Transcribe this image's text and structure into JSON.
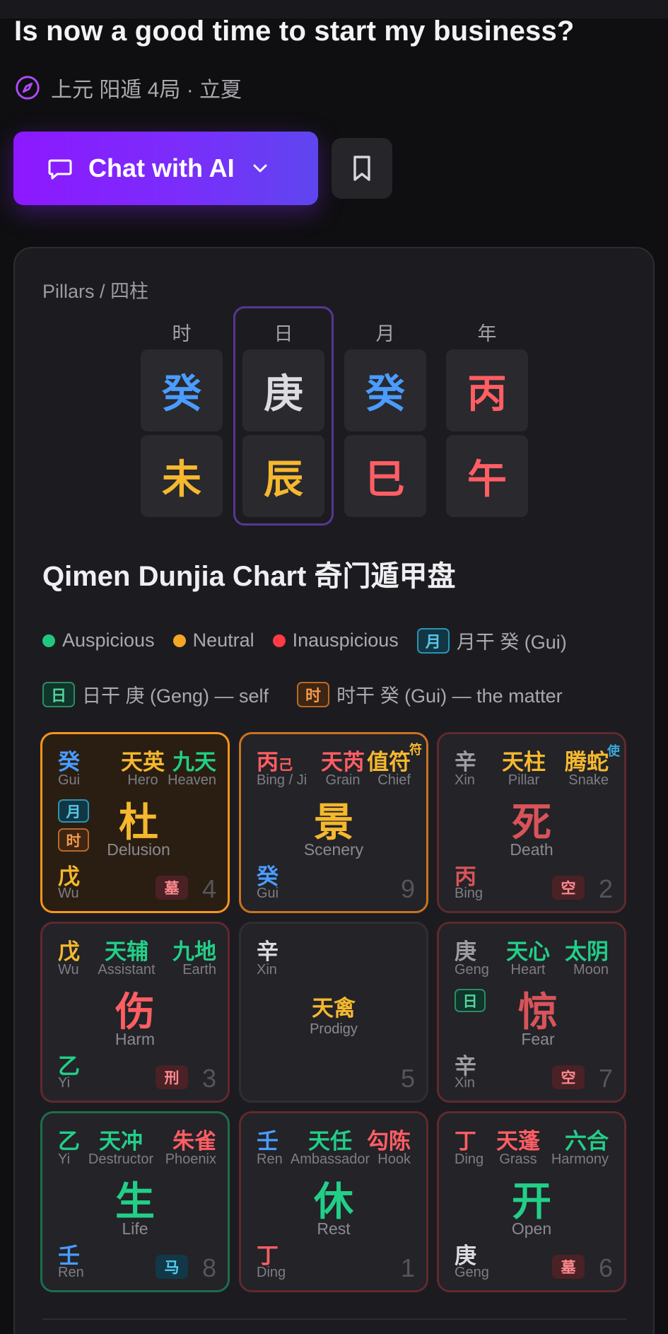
{
  "header": {
    "question": "Is now a good time to start my business?",
    "subtitle": "上元 阳遁 4局 · 立夏"
  },
  "actions": {
    "chat_label": "Chat with AI"
  },
  "pillars": {
    "label": "Pillars / 四柱",
    "columns": [
      {
        "head": "时",
        "stem": "癸",
        "branch": "未"
      },
      {
        "head": "日",
        "stem": "庚",
        "branch": "辰"
      },
      {
        "head": "月",
        "stem": "癸",
        "branch": "巳"
      },
      {
        "head": "年",
        "stem": "丙",
        "branch": "午"
      }
    ]
  },
  "chart": {
    "title": "Qimen Dunjia Chart 奇门遁甲盘",
    "legend": {
      "auspicious": "Auspicious",
      "neutral": "Neutral",
      "inauspicious": "Inauspicious",
      "month_tag": "月",
      "month_text": "月干 癸 (Gui)",
      "day_tag": "日",
      "day_text": "日干 庚 (Geng) — self",
      "hour_tag": "时",
      "hour_text": "时干 癸 (Gui) — the matter"
    },
    "colors": {
      "auspicious": "#1fc77f",
      "neutral": "#f5a623",
      "inauspicious": "#ff3b44"
    },
    "palaces": {
      "p4": {
        "heaven_stem": "癸",
        "heaven_py": "Gui",
        "star": "天英",
        "star_en": "Hero",
        "deity": "九天",
        "deity_en": "Heaven",
        "tag_month": "月",
        "tag_hour": "时",
        "door": "杜",
        "door_en": "Delusion",
        "earth_stem": "戊",
        "earth_py": "Wu",
        "badge": "墓",
        "number": "4"
      },
      "p9": {
        "heaven_stem": "丙",
        "heaven_extra": "己",
        "heaven_py": "Bing / Ji",
        "star": "天芮",
        "star_en": "Grain",
        "deity": "值符",
        "deity_en": "Chief",
        "sup": "符",
        "door": "景",
        "door_en": "Scenery",
        "earth_stem": "癸",
        "earth_py": "Gui",
        "number": "9"
      },
      "p2": {
        "heaven_stem": "辛",
        "heaven_py": "Xin",
        "star": "天柱",
        "star_en": "Pillar",
        "deity": "腾蛇",
        "deity_en": "Snake",
        "sup": "使",
        "door": "死",
        "door_en": "Death",
        "earth_stem": "丙",
        "earth_py": "Bing",
        "badge": "空",
        "number": "2"
      },
      "p3": {
        "heaven_stem": "戊",
        "heaven_py": "Wu",
        "star": "天辅",
        "star_en": "Assistant",
        "deity": "九地",
        "deity_en": "Earth",
        "door": "伤",
        "door_en": "Harm",
        "earth_stem": "乙",
        "earth_py": "Yi",
        "badge": "刑",
        "number": "3"
      },
      "p5": {
        "heaven_stem": "辛",
        "heaven_py": "Xin",
        "star": "天禽",
        "star_en": "Prodigy",
        "number": "5"
      },
      "p7": {
        "heaven_stem": "庚",
        "heaven_py": "Geng",
        "star": "天心",
        "star_en": "Heart",
        "deity": "太阴",
        "deity_en": "Moon",
        "tag_day": "日",
        "door": "惊",
        "door_en": "Fear",
        "earth_stem": "辛",
        "earth_py": "Xin",
        "badge": "空",
        "number": "7"
      },
      "p8": {
        "heaven_stem": "乙",
        "heaven_py": "Yi",
        "star": "天冲",
        "star_en": "Destructor",
        "deity": "朱雀",
        "deity_en": "Phoenix",
        "door": "生",
        "door_en": "Life",
        "earth_stem": "壬",
        "earth_py": "Ren",
        "badge": "马",
        "number": "8"
      },
      "p1": {
        "heaven_stem": "壬",
        "heaven_py": "Ren",
        "star": "天任",
        "star_en": "Ambassador",
        "deity": "勾陈",
        "deity_en": "Hook",
        "door": "休",
        "door_en": "Rest",
        "earth_stem": "丁",
        "earth_py": "Ding",
        "number": "1"
      },
      "p6": {
        "heaven_stem": "丁",
        "heaven_py": "Ding",
        "star": "天蓬",
        "star_en": "Grass",
        "deity": "六合",
        "deity_en": "Harmony",
        "door": "开",
        "door_en": "Open",
        "earth_stem": "庚",
        "earth_py": "Geng",
        "badge": "墓",
        "number": "6"
      }
    }
  }
}
